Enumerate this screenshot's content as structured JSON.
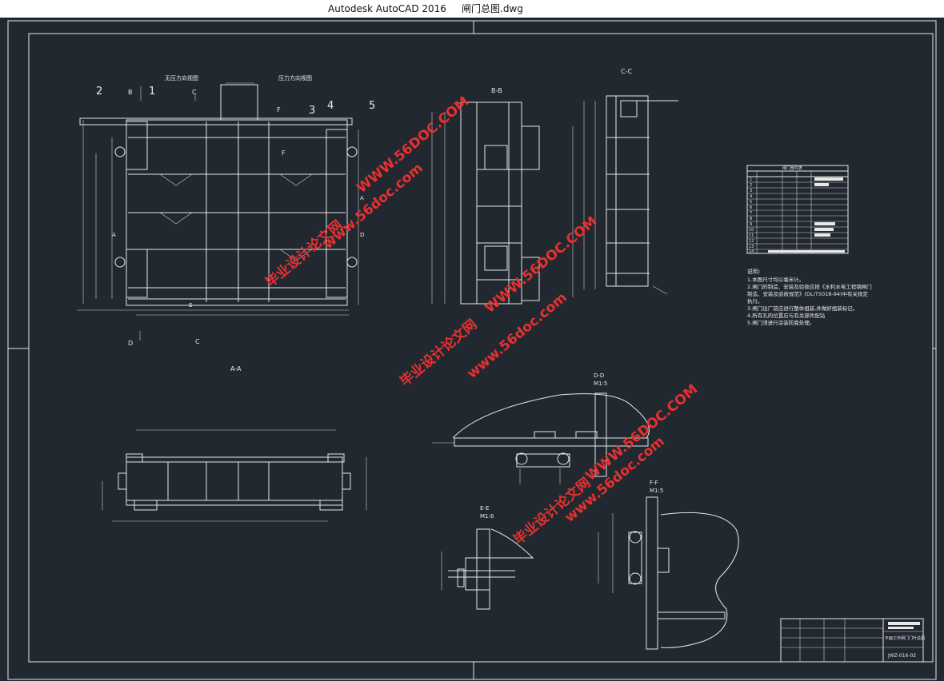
{
  "window": {
    "app_title": "Autodesk AutoCAD 2016",
    "file_name": "闸门总图.dwg"
  },
  "views": {
    "front_left_note": "无压方向视图",
    "front_right_note": "压力方向视图",
    "part_numbers": [
      "1",
      "2",
      "3",
      "4",
      "5"
    ],
    "section_letters": {
      "b": "B",
      "c": "C",
      "d": "D",
      "a": "A",
      "e": "E",
      "f": "F"
    },
    "view_bb": "B-B",
    "view_cc": "C-C",
    "view_aa": "A-A",
    "view_dd": "D-D",
    "view_dd_scale": "M1:5",
    "view_ee": "E-E",
    "view_ee_scale": "M1:6",
    "view_ff": "F-F",
    "view_ff_scale": "M1:5"
  },
  "parts_table": {
    "title": "闸门部件表",
    "rows": [
      "1",
      "2",
      "3",
      "4",
      "5",
      "6",
      "7",
      "8",
      "9",
      "10",
      "11",
      "12",
      "13",
      "14"
    ]
  },
  "notes": {
    "header": "说明:",
    "lines": [
      "1.本图尺寸均以毫米计。",
      "2.闸门的制造、安装及验收应按《水利水电工程钢闸门",
      "制造、安装及验收规范》(DL/T5018-94)中有关规定",
      "执行。",
      "3.闸门出厂前应进行整体组装,并做好组装标记。",
      "4.所有孔的位置应与有关部件配钻",
      "5.闸门须进行涂装防腐处理。"
    ]
  },
  "title_block": {
    "drawing_name": "平面工作闸门门叶总图",
    "drawing_number": "JWZ-016-02"
  },
  "watermarks": {
    "site": "www.56doc.com",
    "site_caps": "WWW.56DOC.COM",
    "brand": "毕业设计论文网"
  },
  "colors": {
    "canvas_bg": "#212830",
    "line": "#e8e8e8",
    "watermark": "#e83030"
  }
}
